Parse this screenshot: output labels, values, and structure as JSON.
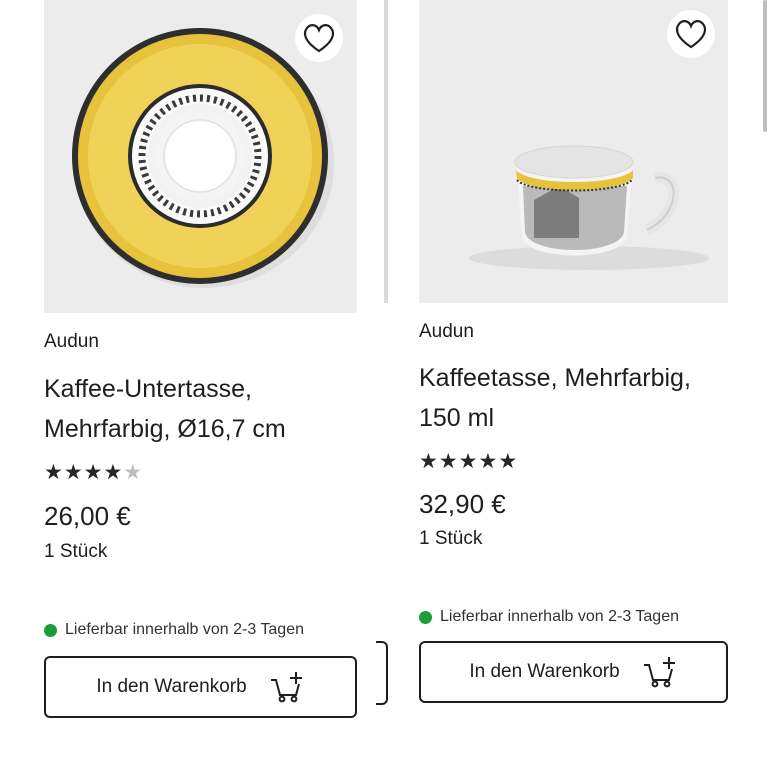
{
  "products": [
    {
      "brand": "Audun",
      "title_line1": "Kaffee-Untertasse,",
      "title_line2": "Mehrfarbig, Ø16,7 cm",
      "rating": 4,
      "rating_max": 5,
      "price": "26,00 €",
      "quantity": "1 Stück",
      "availability": "Lieferbar innerhalb von 2-3 Tagen",
      "cart_label": "In den Warenkorb",
      "image_icon": "saucer-image"
    },
    {
      "brand": "Audun",
      "title_line1": "Kaffeetasse, Mehrfarbig,",
      "title_line2": "150 ml",
      "rating": 5,
      "rating_max": 5,
      "price": "32,90 €",
      "quantity": "1 Stück",
      "availability": "Lieferbar innerhalb von 2-3 Tagen",
      "cart_label": "In den Warenkorb",
      "image_icon": "cup-image"
    }
  ],
  "icons": {
    "favorite": "heart-icon",
    "cart": "cart-add-icon"
  },
  "colors": {
    "availability_dot": "#1b9b3a",
    "image_background": "#ececed",
    "text": "#1e1e1e"
  }
}
